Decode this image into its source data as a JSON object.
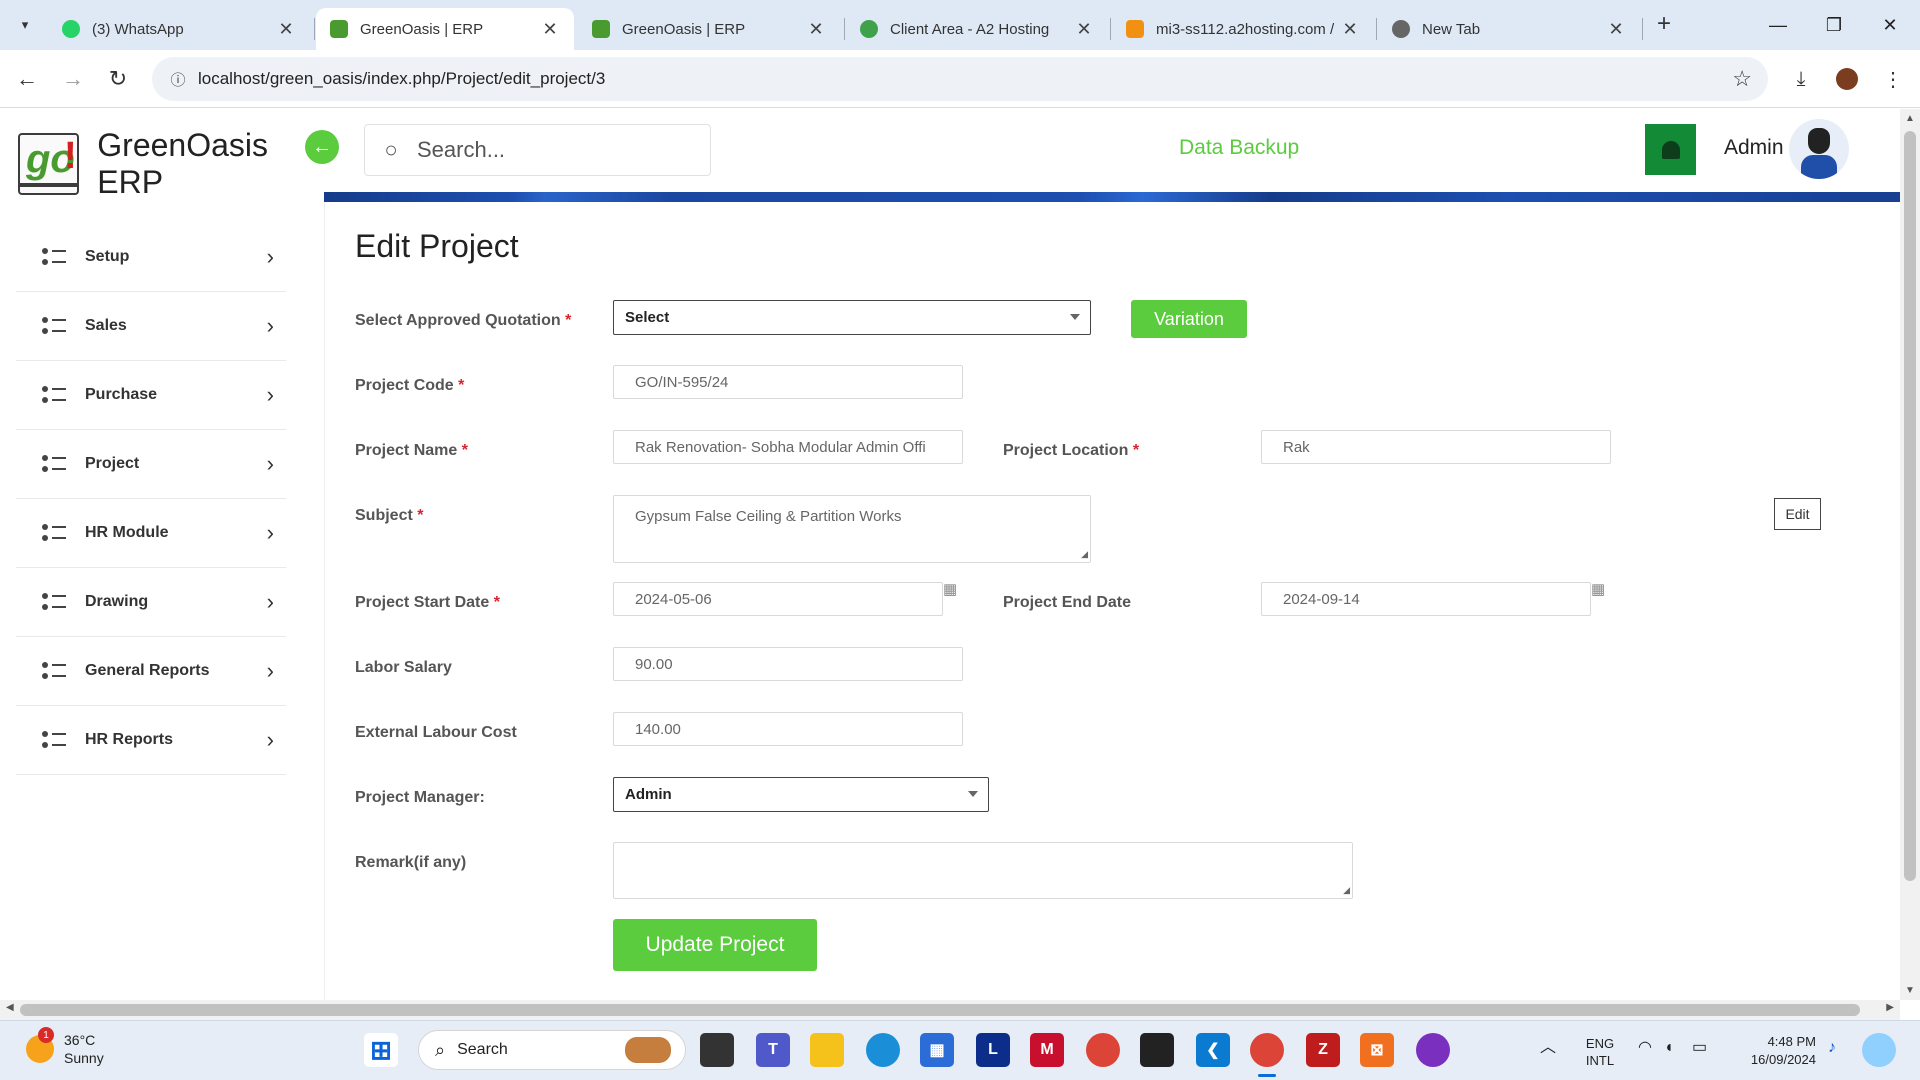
{
  "browser": {
    "tabs": [
      {
        "title": "(3) WhatsApp",
        "icon": "whatsapp-icon",
        "active": false
      },
      {
        "title": "GreenOasis | ERP",
        "icon": "greenoasis-icon",
        "active": true
      },
      {
        "title": "GreenOasis | ERP",
        "icon": "greenoasis-icon",
        "active": false
      },
      {
        "title": "Client Area - A2 Hosting",
        "icon": "a2hosting-icon",
        "active": false
      },
      {
        "title": "mi3-ss112.a2hosting.com /",
        "icon": "phpmyadmin-icon",
        "active": false
      },
      {
        "title": "New Tab",
        "icon": "chrome-icon",
        "active": false
      }
    ],
    "url": "localhost/green_oasis/index.php/Project/edit_project/3"
  },
  "app": {
    "brand": "GreenOasis ERP",
    "search_placeholder": "Search...",
    "data_backup": "Data Backup",
    "user": "Admin",
    "accent": "#5bcc3e"
  },
  "sidebar": {
    "items": [
      {
        "label": "Setup"
      },
      {
        "label": "Sales"
      },
      {
        "label": "Purchase"
      },
      {
        "label": "Project"
      },
      {
        "label": "HR Module"
      },
      {
        "label": "Drawing"
      },
      {
        "label": "General Reports"
      },
      {
        "label": "HR Reports"
      }
    ]
  },
  "form": {
    "title": "Edit Project",
    "quotation_label": "Select Approved Quotation",
    "quotation_value": "Select",
    "variation_button": "Variation",
    "project_code_label": "Project Code",
    "project_code_value": "GO/IN-595/24",
    "project_name_label": "Project Name",
    "project_name_value": "Rak Renovation- Sobha Modular Admin Offi",
    "project_location_label": "Project Location",
    "project_location_value": "Rak",
    "subject_label": "Subject",
    "subject_value": "Gypsum False Ceiling & Partition Works",
    "edit_button": "Edit",
    "start_date_label": "Project Start Date",
    "start_date_value": "2024-05-06",
    "end_date_label": "Project End Date",
    "end_date_value": "2024-09-14",
    "labor_salary_label": "Labor Salary",
    "labor_salary_value": "90.00",
    "external_labour_label": "External Labour Cost",
    "external_labour_value": "140.00",
    "manager_label": "Project Manager:",
    "manager_value": "Admin",
    "remark_label": "Remark(if any)",
    "remark_value": "",
    "update_button": "Update Project",
    "required_mark": "*"
  },
  "taskbar": {
    "temperature": "36°C",
    "weather": "Sunny",
    "weather_badge": "1",
    "search": "Search",
    "lang1": "ENG",
    "lang2": "INTL",
    "time": "4:48 PM",
    "date": "16/09/2024"
  }
}
